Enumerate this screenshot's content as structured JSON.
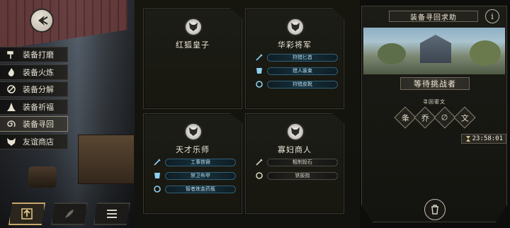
{
  "side_menu": {
    "items": [
      {
        "label": "装备打磨",
        "icon": "hammer-icon"
      },
      {
        "label": "装备火炼",
        "icon": "flame-icon"
      },
      {
        "label": "装备分解",
        "icon": "disassemble-icon"
      },
      {
        "label": "装备祈福",
        "icon": "pray-icon"
      },
      {
        "label": "装备寻回",
        "icon": "spiral-icon"
      },
      {
        "label": "友谊商店",
        "icon": "fox-icon"
      }
    ],
    "active_index": 4
  },
  "bottom_tabs": [
    {
      "icon": "upload-icon",
      "active": true
    },
    {
      "icon": "feather-icon",
      "active": false
    },
    {
      "icon": "list-icon",
      "active": false
    }
  ],
  "cards": [
    {
      "name": "红狐皇子",
      "items": []
    },
    {
      "name": "华彩将军",
      "items": [
        {
          "label": "狩猎匕首",
          "style": "blue",
          "icon": "dagger-icon"
        },
        {
          "label": "猎人装束",
          "style": "blue",
          "icon": "armor-icon"
        },
        {
          "label": "狩猎皮靴",
          "style": "blue",
          "icon": "ring-icon"
        }
      ]
    },
    {
      "name": "天才乐师",
      "items": [
        {
          "label": "工事铁锹",
          "style": "blue",
          "icon": "dagger-icon"
        },
        {
          "label": "禁卫布甲",
          "style": "blue",
          "icon": "armor-icon"
        },
        {
          "label": "智者炼金药瓶",
          "style": "blue",
          "icon": "ring-icon"
        }
      ]
    },
    {
      "name": "寡妇商人",
      "items": [
        {
          "label": "粗制投石",
          "style": "gray",
          "icon": "dagger-icon"
        },
        {
          "label": "铁扳指",
          "style": "gray",
          "icon": "ring-icon"
        }
      ]
    }
  ],
  "right_panel": {
    "title": "装备寻回求助",
    "info": "i",
    "status": "等待挑战者",
    "cipher_label": "寻回密文",
    "runes": [
      "夆",
      "乔",
      "∅",
      "文"
    ],
    "timer": "23:58:01"
  }
}
